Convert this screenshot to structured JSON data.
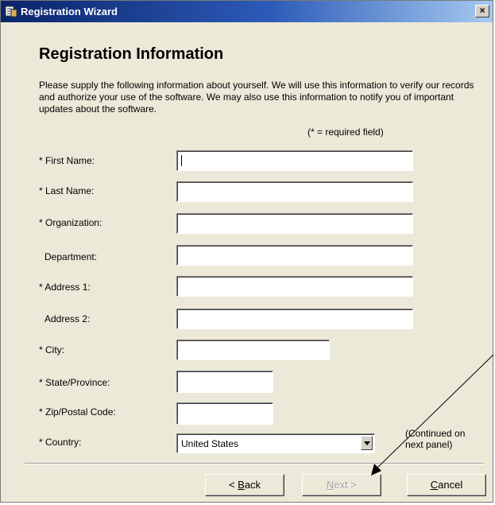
{
  "window": {
    "title": "Registration Wizard",
    "close_glyph": "×",
    "app_icon": "registration-app-icon"
  },
  "page": {
    "heading": "Registration Information",
    "intro": "Please supply the following information about yourself.  We will use this information to verify our records and authorize your use of the software.  We may also use this information to notify you of important updates about the software.",
    "required_note": "(* = required field)"
  },
  "form": {
    "first_name": {
      "label": "* First Name:",
      "value": ""
    },
    "last_name": {
      "label": "* Last Name:",
      "value": ""
    },
    "organization": {
      "label": "* Organization:",
      "value": ""
    },
    "department": {
      "label": "Department:",
      "value": ""
    },
    "address1": {
      "label": "* Address 1:",
      "value": ""
    },
    "address2": {
      "label": "Address 2:",
      "value": ""
    },
    "city": {
      "label": "* City:",
      "value": ""
    },
    "state": {
      "label": "* State/Province:",
      "value": ""
    },
    "zip": {
      "label": "* Zip/Postal Code:",
      "value": ""
    },
    "country": {
      "label": "* Country:",
      "value": "United States"
    }
  },
  "continued_note": "(Continued on next panel)",
  "buttons": {
    "back_prefix": "< ",
    "back_key": "B",
    "back_rest": "ack",
    "next_key": "N",
    "next_rest": "ext >",
    "cancel_key": "C",
    "cancel_rest": "ancel"
  },
  "colors": {
    "titlebar_start": "#0a246a",
    "titlebar_end": "#a6caf0",
    "dialog_bg": "#ece9d8"
  }
}
